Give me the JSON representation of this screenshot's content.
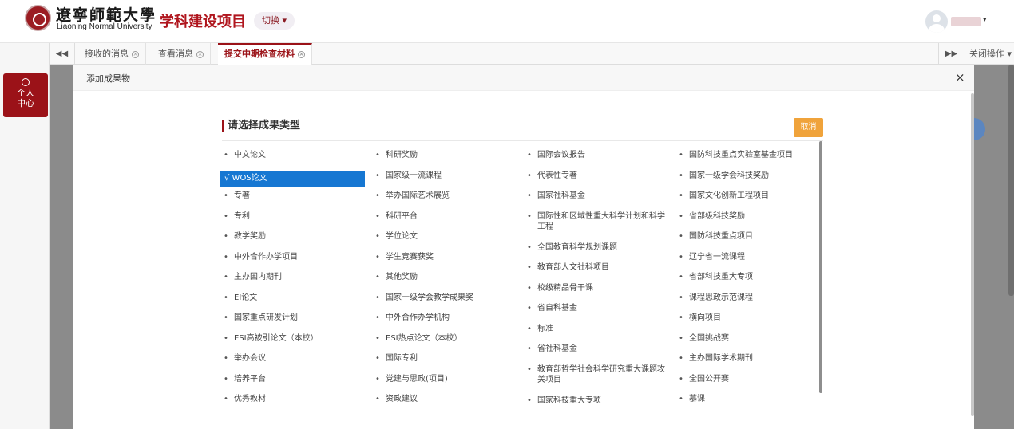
{
  "header": {
    "logo_cn": "遼寧師範大學",
    "logo_en": "Liaoning Normal University",
    "app_title": "学科建设项目",
    "switch_label": "切换 ▾",
    "user_caret": "▾"
  },
  "sidebar": {
    "personal_center": "个人中心"
  },
  "tabs": {
    "prev_label": "◀◀",
    "next_label": "▶▶",
    "items": [
      {
        "label": "接收的消息"
      },
      {
        "label": "查看消息"
      },
      {
        "label": "提交中期检查材料"
      }
    ],
    "close_ops": "关闭操作 ▾"
  },
  "modal": {
    "title": "添加成果物",
    "close": "×",
    "section_title": "请选择成果类型",
    "cancel": "取消",
    "columns": [
      [
        "中文论文",
        "√ WOS论文",
        "专著",
        "专利",
        "教学奖励",
        "中外合作办学项目",
        "主办国内期刊",
        "EI论文",
        "国家重点研发计划",
        "ESI高被引论文（本校）",
        "举办会议",
        "培养平台",
        "优秀教材"
      ],
      [
        "科研奖励",
        "国家级一流课程",
        "举办国际艺术展览",
        "科研平台",
        "学位论文",
        "学生竞赛获奖",
        "其他奖励",
        "国家一级学会教学成果奖",
        "中外合作办学机构",
        "ESI热点论文（本校）",
        "国际专利",
        "党建与思政(项目)",
        "资政建议"
      ],
      [
        "国际会议报告",
        "代表性专著",
        "国家社科基金",
        "国际性和区域性重大科学计划和科学工程",
        "全国教育科学规划课题",
        "教育部人文社科项目",
        "校级精品骨干课",
        "省自科基金",
        "标准",
        "省社科基金",
        "教育部哲学社会科学研究重大课题攻关项目",
        "国家科技重大专项"
      ],
      [
        "国防科技重点实验室基金项目",
        "国家一级学会科技奖励",
        "国家文化创新工程项目",
        "省部级科技奖励",
        "国防科技重点项目",
        "辽宁省一流课程",
        "省部科技重大专项",
        "课程思政示范课程",
        "横向项目",
        "全国挑战赛",
        "主办国际学术期刊",
        "全国公开赛",
        "慕课"
      ]
    ],
    "selected": "√ WOS论文"
  }
}
